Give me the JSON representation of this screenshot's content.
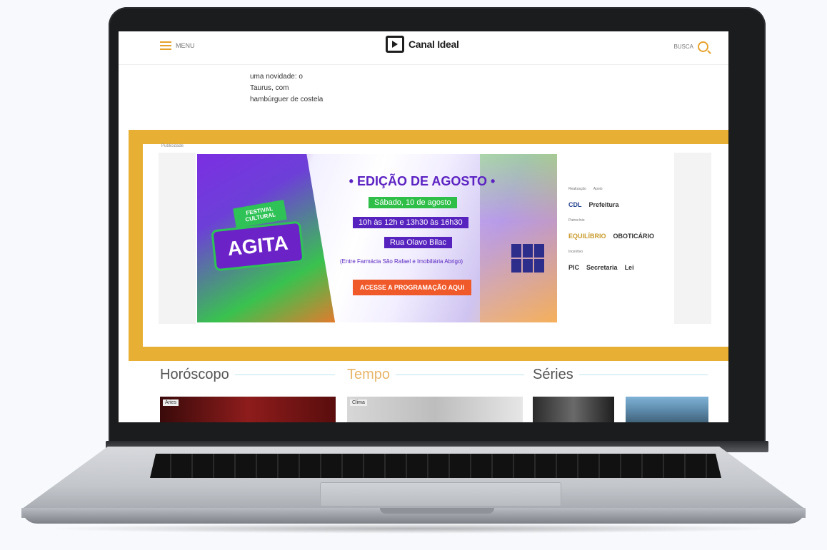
{
  "header": {
    "menu_label": "MENU",
    "logo_text": "Canal Ideal",
    "search_label": "BUSCA"
  },
  "article": {
    "snippet_lines": [
      "uma novidade: o",
      "Taurus, com",
      "hambúrguer de costela"
    ]
  },
  "ad": {
    "publicidade_label": "Publicidade",
    "festival_tag": "FESTIVAL CULTURAL",
    "badge": "AGITA",
    "edition_title": "• EDIÇÃO DE AGOSTO •",
    "date": "Sábado, 10 de agosto",
    "time": "10h às 12h e 13h30 às 16h30",
    "address": "Rua Olavo Bilac",
    "address_note": "(Entre Farmácia São Rafael e Imobiliária Abrigo)",
    "cta": "ACESSE A PROGRAMAÇÃO AQUI",
    "sponsors": {
      "row1_small": [
        "Realização",
        "Apoio"
      ],
      "row1_logos": [
        "CDL",
        "Prefeitura"
      ],
      "row2_small": "Patrocínio",
      "row2_logos": [
        "EQUILÍBRIO",
        "OBOTICÁRIO"
      ],
      "row3_small": "Incentivo",
      "row3_logos": [
        "PIC",
        "Secretaria",
        "Lei"
      ]
    }
  },
  "sections": {
    "horoscope": "Horóscopo",
    "weather": "Tempo",
    "series": "Séries",
    "thumb1_label": "Áries",
    "thumb2_label": "Clima"
  },
  "colors": {
    "highlight": "#e7b034",
    "accent": "#e6a22c",
    "purple": "#5723bf",
    "green": "#2fbf49",
    "orange": "#f05a2a"
  }
}
